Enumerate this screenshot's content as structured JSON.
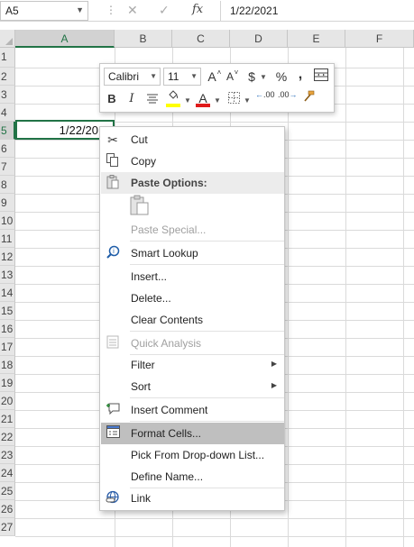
{
  "formula_bar": {
    "name_box": "A5",
    "fx_label": "fx",
    "formula_value": "1/22/2021"
  },
  "columns": [
    "A",
    "B",
    "C",
    "D",
    "E",
    "F"
  ],
  "rows": [
    "1",
    "2",
    "3",
    "4",
    "5",
    "6",
    "7",
    "8",
    "9",
    "10",
    "11",
    "12",
    "13",
    "14",
    "15",
    "16",
    "17",
    "18",
    "19",
    "20",
    "21",
    "22",
    "23",
    "24",
    "25",
    "26",
    "27"
  ],
  "selected_cell": {
    "address": "A5",
    "display": "1/22/20"
  },
  "mini_toolbar": {
    "font_name": "Calibri",
    "font_size": "11",
    "buttons": {
      "increase_font": "A",
      "decrease_font": "A",
      "currency": "$",
      "percent": "%",
      "comma": ",",
      "bold": "B",
      "italic": "I",
      "font_color": "A",
      "increase_decimal": ".00",
      "decrease_decimal": ".00"
    },
    "colors": {
      "highlight": "#ffff00",
      "font_color": "#e01b1b"
    }
  },
  "context_menu": {
    "items": [
      {
        "label": "Cut",
        "icon": "scissors-icon"
      },
      {
        "label": "Copy",
        "icon": "copy-icon"
      },
      {
        "label": "Paste Options:",
        "icon": "paste-icon"
      },
      {
        "label": "Paste Special...",
        "icon": ""
      },
      {
        "label": "Smart Lookup",
        "icon": "smart-lookup-icon"
      },
      {
        "label": "Insert...",
        "icon": ""
      },
      {
        "label": "Delete...",
        "icon": ""
      },
      {
        "label": "Clear Contents",
        "icon": ""
      },
      {
        "label": "Quick Analysis",
        "icon": "quick-analysis-icon"
      },
      {
        "label": "Filter",
        "icon": ""
      },
      {
        "label": "Sort",
        "icon": ""
      },
      {
        "label": "Insert Comment",
        "icon": "comment-icon"
      },
      {
        "label": "Format Cells...",
        "icon": "format-cells-icon"
      },
      {
        "label": "Pick From Drop-down List...",
        "icon": ""
      },
      {
        "label": "Define Name...",
        "icon": ""
      },
      {
        "label": "Link",
        "icon": "link-icon"
      }
    ]
  },
  "theme": {
    "accent": "#217346",
    "menu_highlight": "#bfbfbf"
  }
}
